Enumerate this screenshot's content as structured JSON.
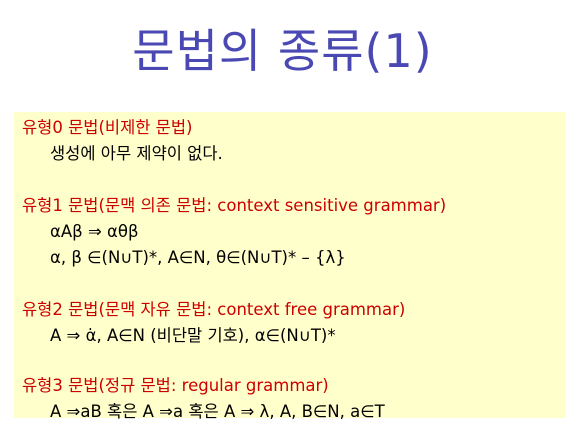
{
  "slide": {
    "title": "문법의 종류(1)"
  },
  "types": [
    {
      "heading": "유형0 문법(비제한 문법)",
      "lines": [
        "생성에 아무 제약이 없다."
      ]
    },
    {
      "heading": "유형1 문법(문맥 의존 문법: context sensitive grammar)",
      "lines": [
        "αAβ ⇒ αθβ",
        "α, β ∈(N∪T)*, A∈N, θ∈(N∪T)* – {λ}"
      ]
    },
    {
      "heading": "유형2 문법(문맥 자유 문법: context free grammar)",
      "lines": [
        "A ⇒ α̇,  A∈N (비단말 기호), α∈(N∪T)*"
      ]
    },
    {
      "heading": "유형3 문법(정규 문법: regular grammar)",
      "lines": [
        "A ⇒aB 혹은 A ⇒a 혹은 A ⇒ λ,  A, B∈N, a∈T"
      ]
    }
  ],
  "colors": {
    "title": "#4a49b3",
    "heading": "#cc0000",
    "panel_background": "#ffffcc"
  }
}
